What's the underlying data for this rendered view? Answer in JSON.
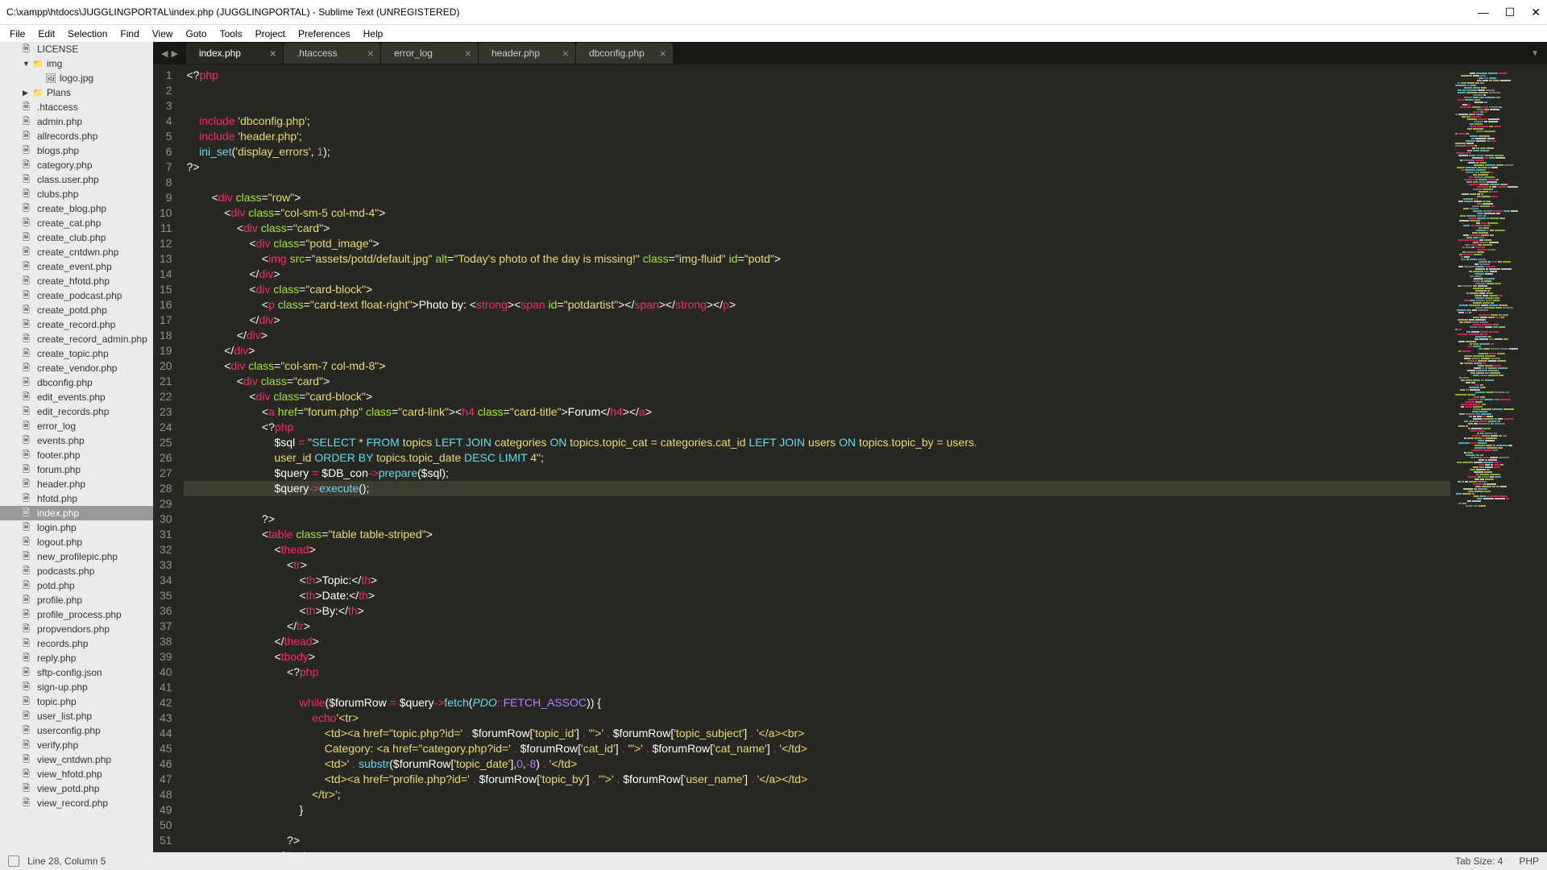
{
  "window": {
    "title": "C:\\xampp\\htdocs\\JUGGLINGPORTAL\\index.php (JUGGLINGPORTAL) - Sublime Text (UNREGISTERED)",
    "min": "—",
    "max": "☐",
    "close": "✕"
  },
  "menu": [
    "File",
    "Edit",
    "Selection",
    "Find",
    "View",
    "Goto",
    "Tools",
    "Project",
    "Preferences",
    "Help"
  ],
  "sidebar": {
    "items": [
      {
        "type": "file",
        "label": "LICENSE",
        "indent": "file"
      },
      {
        "type": "folder",
        "label": "img",
        "open": true,
        "indent": "folder2"
      },
      {
        "type": "file",
        "label": "logo.jpg",
        "indent": "file2",
        "icon": "🖼"
      },
      {
        "type": "folder",
        "label": "Plans",
        "open": false,
        "indent": "folder2"
      },
      {
        "type": "file",
        "label": ".htaccess",
        "indent": "file"
      },
      {
        "type": "file",
        "label": "admin.php",
        "indent": "file"
      },
      {
        "type": "file",
        "label": "allrecords.php",
        "indent": "file"
      },
      {
        "type": "file",
        "label": "blogs.php",
        "indent": "file"
      },
      {
        "type": "file",
        "label": "category.php",
        "indent": "file"
      },
      {
        "type": "file",
        "label": "class.user.php",
        "indent": "file"
      },
      {
        "type": "file",
        "label": "clubs.php",
        "indent": "file"
      },
      {
        "type": "file",
        "label": "create_blog.php",
        "indent": "file"
      },
      {
        "type": "file",
        "label": "create_cat.php",
        "indent": "file"
      },
      {
        "type": "file",
        "label": "create_club.php",
        "indent": "file"
      },
      {
        "type": "file",
        "label": "create_cntdwn.php",
        "indent": "file"
      },
      {
        "type": "file",
        "label": "create_event.php",
        "indent": "file"
      },
      {
        "type": "file",
        "label": "create_hfotd.php",
        "indent": "file"
      },
      {
        "type": "file",
        "label": "create_podcast.php",
        "indent": "file"
      },
      {
        "type": "file",
        "label": "create_potd.php",
        "indent": "file"
      },
      {
        "type": "file",
        "label": "create_record.php",
        "indent": "file"
      },
      {
        "type": "file",
        "label": "create_record_admin.php",
        "indent": "file"
      },
      {
        "type": "file",
        "label": "create_topic.php",
        "indent": "file"
      },
      {
        "type": "file",
        "label": "create_vendor.php",
        "indent": "file"
      },
      {
        "type": "file",
        "label": "dbconfig.php",
        "indent": "file"
      },
      {
        "type": "file",
        "label": "edit_events.php",
        "indent": "file"
      },
      {
        "type": "file",
        "label": "edit_records.php",
        "indent": "file"
      },
      {
        "type": "file",
        "label": "error_log",
        "indent": "file"
      },
      {
        "type": "file",
        "label": "events.php",
        "indent": "file"
      },
      {
        "type": "file",
        "label": "footer.php",
        "indent": "file"
      },
      {
        "type": "file",
        "label": "forum.php",
        "indent": "file"
      },
      {
        "type": "file",
        "label": "header.php",
        "indent": "file"
      },
      {
        "type": "file",
        "label": "hfotd.php",
        "indent": "file"
      },
      {
        "type": "file",
        "label": "index.php",
        "indent": "file",
        "selected": true
      },
      {
        "type": "file",
        "label": "login.php",
        "indent": "file"
      },
      {
        "type": "file",
        "label": "logout.php",
        "indent": "file"
      },
      {
        "type": "file",
        "label": "new_profilepic.php",
        "indent": "file"
      },
      {
        "type": "file",
        "label": "podcasts.php",
        "indent": "file"
      },
      {
        "type": "file",
        "label": "potd.php",
        "indent": "file"
      },
      {
        "type": "file",
        "label": "profile.php",
        "indent": "file"
      },
      {
        "type": "file",
        "label": "profile_process.php",
        "indent": "file"
      },
      {
        "type": "file",
        "label": "propvendors.php",
        "indent": "file"
      },
      {
        "type": "file",
        "label": "records.php",
        "indent": "file"
      },
      {
        "type": "file",
        "label": "reply.php",
        "indent": "file"
      },
      {
        "type": "file",
        "label": "sftp-config.json",
        "indent": "file"
      },
      {
        "type": "file",
        "label": "sign-up.php",
        "indent": "file"
      },
      {
        "type": "file",
        "label": "topic.php",
        "indent": "file"
      },
      {
        "type": "file",
        "label": "user_list.php",
        "indent": "file"
      },
      {
        "type": "file",
        "label": "userconfig.php",
        "indent": "file"
      },
      {
        "type": "file",
        "label": "verify.php",
        "indent": "file"
      },
      {
        "type": "file",
        "label": "view_cntdwn.php",
        "indent": "file"
      },
      {
        "type": "file",
        "label": "view_hfotd.php",
        "indent": "file"
      },
      {
        "type": "file",
        "label": "view_potd.php",
        "indent": "file"
      },
      {
        "type": "file",
        "label": "view_record.php",
        "indent": "file"
      }
    ]
  },
  "tabs": [
    {
      "label": "index.php",
      "active": true
    },
    {
      "label": ".htaccess",
      "active": false
    },
    {
      "label": "error_log",
      "active": false
    },
    {
      "label": "header.php",
      "active": false
    },
    {
      "label": "dbconfig.php",
      "active": false
    }
  ],
  "statusbar": {
    "position": "Line 28, Column 5",
    "tabsize": "Tab Size: 4",
    "syntax": "PHP"
  },
  "lines_start": 1,
  "lines_end": 51
}
